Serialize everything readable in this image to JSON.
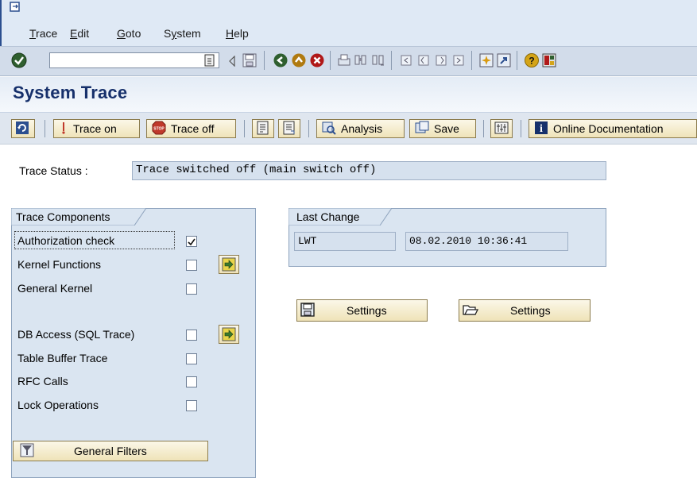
{
  "menu": {
    "items": [
      {
        "pre": "",
        "u": "T",
        "post": "race"
      },
      {
        "pre": "",
        "u": "E",
        "post": "dit"
      },
      {
        "pre": "",
        "u": "G",
        "post": "oto"
      },
      {
        "pre": "S",
        "u": "y",
        "post": "stem"
      },
      {
        "pre": "",
        "u": "H",
        "post": "elp"
      }
    ]
  },
  "toolbar": {
    "command_value": "",
    "icons": [
      "enter-icon",
      "back-arrow-icon",
      "save-icon",
      "back-icon",
      "exit-icon",
      "cancel-icon",
      "print-icon",
      "find-icon",
      "find-next-icon",
      "first-page-icon",
      "previous-page-icon",
      "next-page-icon",
      "last-page-icon",
      "create-session-icon",
      "shortcut-icon",
      "help-icon",
      "customize-layout-icon"
    ]
  },
  "title": "System Trace",
  "app_toolbar": {
    "trace_on": "Trace on",
    "trace_off": "Trace off",
    "analysis": "Analysis",
    "save": "Save",
    "online_documentation": "Online Documentation"
  },
  "status": {
    "label": "Trace Status :",
    "value": "Trace switched off (main switch off)"
  },
  "components": {
    "title": "Trace Components",
    "items": [
      {
        "label": "Authorization check",
        "checked": true
      },
      {
        "label": "Kernel Functions",
        "checked": false
      },
      {
        "label": "General Kernel",
        "checked": false
      },
      {
        "label": "DB Access (SQL Trace)",
        "checked": false
      },
      {
        "label": "Table Buffer Trace",
        "checked": false
      },
      {
        "label": "RFC Calls",
        "checked": false
      },
      {
        "label": "Lock Operations",
        "checked": false
      }
    ],
    "general_filters": "General Filters"
  },
  "last_change": {
    "title": "Last Change",
    "user": "LWT",
    "datetime": "08.02.2010 10:36:41"
  },
  "settings": {
    "save_settings": "Settings",
    "open_settings": "Settings"
  },
  "colors": {
    "title": "#16306b",
    "button_bg": "#efe3b8",
    "group_bg": "#dae5f1"
  }
}
